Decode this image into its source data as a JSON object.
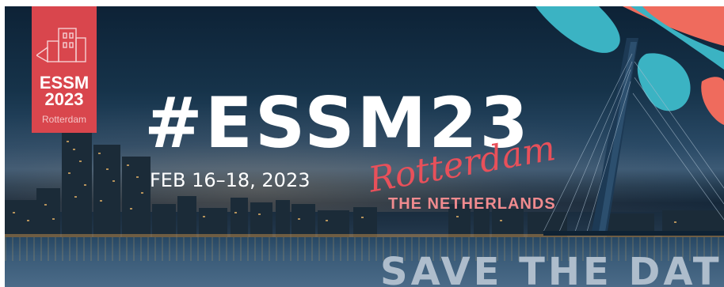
{
  "banner": {
    "logo": {
      "line1": "ESSM",
      "line2": "2023",
      "city": "Rotterdam"
    },
    "hashtag": "#ESSM23",
    "date": "FEB 16–18, 2023",
    "city_script": "Rotterdam",
    "country": "THE NETHERLANDS",
    "save_the_date": "SAVE THE DATE"
  },
  "colors": {
    "accent": "#d9464d",
    "script": "#e8505a",
    "teal": "#3bb3c3",
    "coral": "#ef6b5d",
    "sky": "#16334a"
  },
  "icons": [
    "rotterdam-skyline-logo-icon",
    "erasmus-bridge-illustration"
  ]
}
